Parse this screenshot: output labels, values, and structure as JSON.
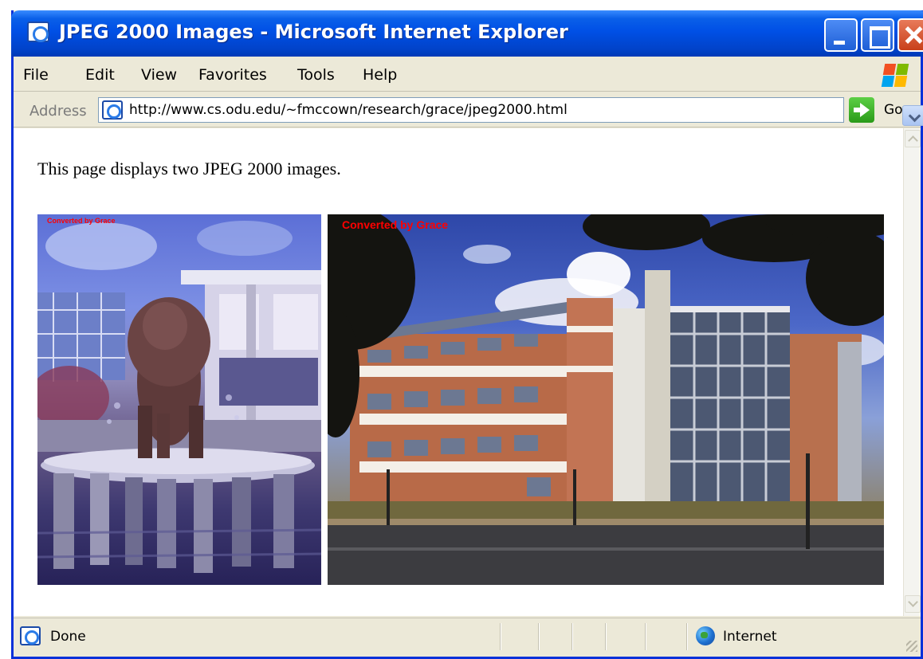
{
  "window": {
    "title": "JPEG 2000 Images - Microsoft Internet Explorer"
  },
  "menu": {
    "file": "File",
    "edit": "Edit",
    "view": "View",
    "favorites": "Favorites",
    "tools": "Tools",
    "help": "Help"
  },
  "address": {
    "label": "Address",
    "url": "http://www.cs.odu.edu/~fmccown/research/grace/jpeg2000.html",
    "go_label": "Go"
  },
  "page": {
    "intro": "This page displays two JPEG 2000 images.",
    "images": [
      {
        "subject": "lion statue fountain",
        "watermark": "Converted by Grace"
      },
      {
        "subject": "campus building",
        "watermark": "Converted by Grace"
      }
    ]
  },
  "status": {
    "text": "Done",
    "zone": "Internet"
  },
  "icons": {
    "window": "ie-icon",
    "address": "ie-page-icon",
    "status": "ie-page-icon",
    "zone": "globe-icon",
    "go": "go-arrow-icon",
    "logo": "windows-logo-icon"
  },
  "colors": {
    "titlebar": "#0050e6",
    "chrome": "#ece9d8",
    "close": "#c8401a",
    "watermark": "#ff0000"
  }
}
